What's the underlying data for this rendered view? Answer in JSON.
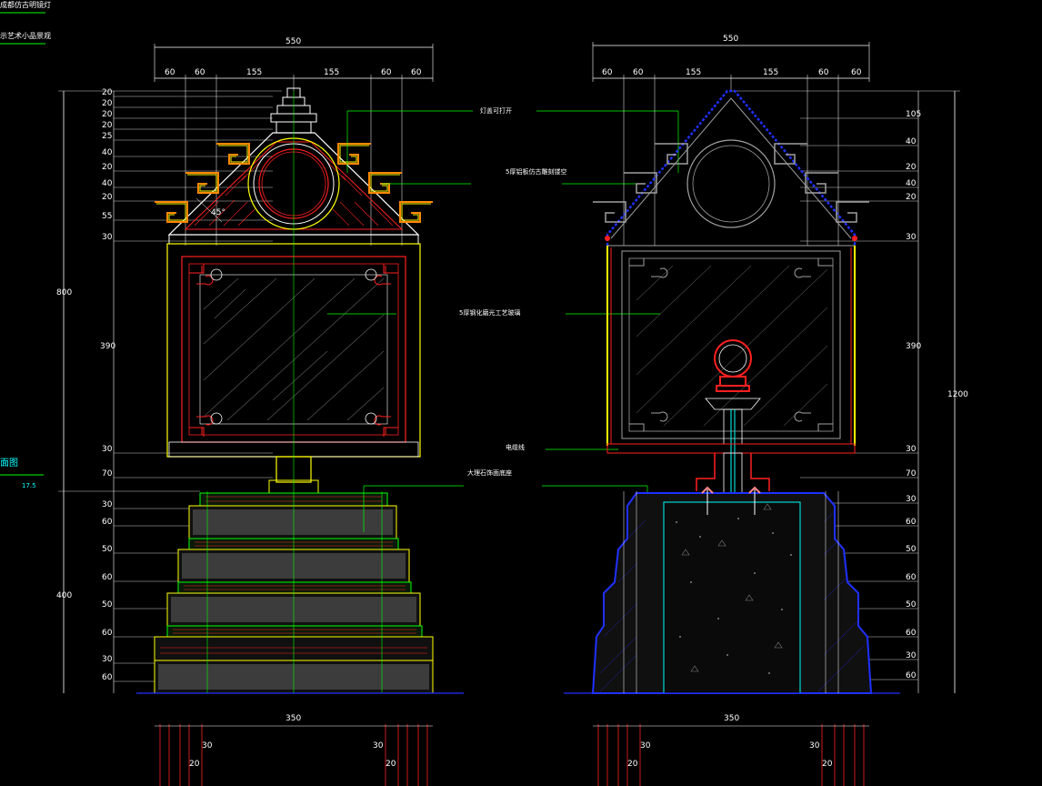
{
  "titles": {
    "top": "成都仿古明镜灯",
    "sub": "示艺术小品景观",
    "left_bottom": "面图",
    "small_num": "17.5"
  },
  "dims": {
    "width_total_left": "550",
    "width_total_right": "550",
    "top_segments_left": [
      "60",
      "60",
      "155",
      "155",
      "60",
      "60"
    ],
    "top_segments_right": [
      "60",
      "60",
      "155",
      "155",
      "60",
      "60"
    ],
    "base_width_left": "350",
    "base_width_right": "350",
    "total_height": "1200",
    "head_height": "800",
    "base_height": "400",
    "body_height_left": "390",
    "body_height_right": "390",
    "left_stack": [
      "20",
      "20",
      "20",
      "20",
      "25",
      "40",
      "20",
      "40",
      "20",
      "55",
      "30",
      "30",
      "70",
      "30",
      "60",
      "50",
      "60",
      "50",
      "60",
      "30",
      "60"
    ],
    "right_stack": [
      "105",
      "40",
      "20",
      "40",
      "20",
      "30",
      "30",
      "70",
      "30",
      "60",
      "50",
      "60",
      "50",
      "60",
      "30",
      "60"
    ],
    "bottom_marks": [
      "30",
      "20",
      "30",
      "20",
      "30",
      "20",
      "30",
      "20"
    ]
  },
  "notes": {
    "top_cover": "灯盖可打开",
    "roof": "5厚铝板仿古雕刻镂空",
    "glass": "5厚钢化磨光工艺玻璃",
    "cable": "电缆线",
    "base": "大理石饰面底座"
  },
  "colors": {
    "background": "#000000",
    "dim_line": "#ffffff",
    "leader": "#00ff00",
    "red": "#ff2020",
    "yellow": "#ffff00",
    "cyan": "#00ffff",
    "blue": "#2030ff",
    "orange": "#ff8800",
    "gray": "#a0a0a0"
  }
}
